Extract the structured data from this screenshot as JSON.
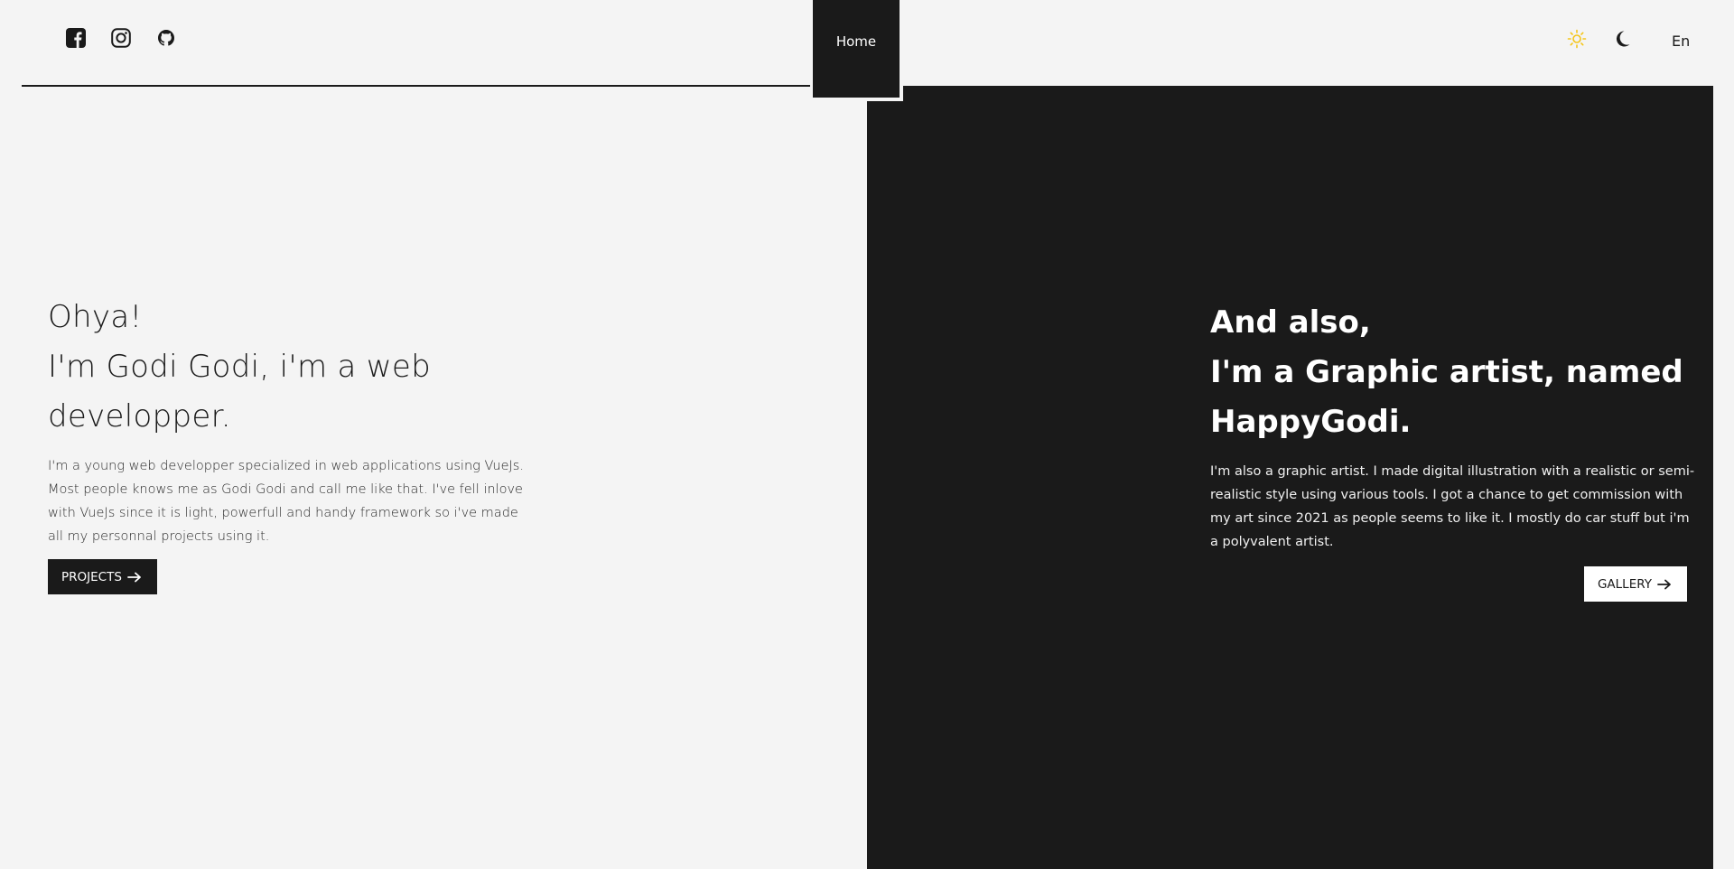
{
  "header": {
    "socials": [
      {
        "icon": "facebook-icon"
      },
      {
        "icon": "instagram-icon"
      },
      {
        "icon": "github-icon"
      }
    ],
    "nav_home_label": "Home",
    "theme": {
      "light_icon": "sun-icon",
      "dark_icon": "moon-icon",
      "light_color": "#f5c518"
    },
    "language_label": "En"
  },
  "left": {
    "title_line_1": "Ohya!",
    "title_line_2": "I'm Godi Godi, i'm a web",
    "title_line_3": "developper.",
    "description": "I'm a young web developper specialized in web applications using VueJs. Most people knows me as Godi Godi and call me like that. I've fell inlove with VueJs since it is light, powerfull and handy framework so i've made all my personnal projects using it.",
    "button_label": "PROJECTS"
  },
  "right": {
    "title_line_1": "And also,",
    "title_line_2": "I'm a Graphic artist, named",
    "title_line_3": "HappyGodi.",
    "description": "I'm also a graphic artist. I made digital illustration with a realistic or semi-realistic style using various tools. I got a chance to get commission with my art since 2021 as people seems to like it. I mostly do car stuff but i'm a polyvalent artist.",
    "button_label": "GALLERY"
  },
  "colors": {
    "background": "#f4f4f4",
    "dark": "#1a1a1a",
    "accent_sun": "#f5c518"
  }
}
